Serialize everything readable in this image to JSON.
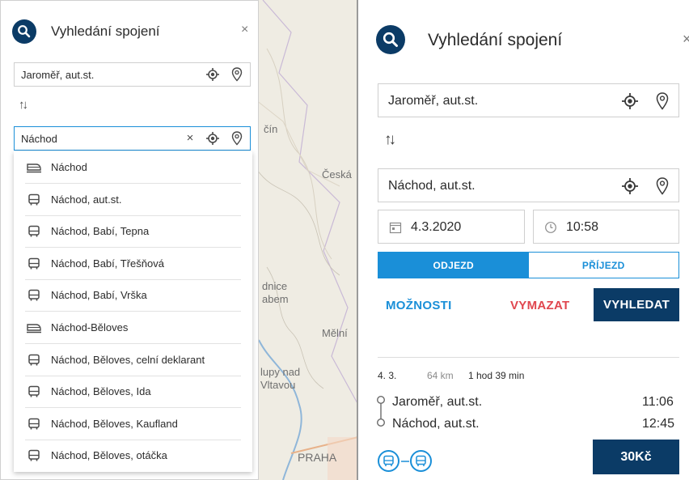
{
  "left": {
    "title": "Vyhledání spojení",
    "close": "×",
    "from_value": "Jaroměř, aut.st.",
    "to_value": "Náchod",
    "clear": "×",
    "swap": "↑↓",
    "map_labels": [
      "čín",
      "Česká",
      "dnice",
      "abem",
      "Mělní",
      "lupy nad",
      "Vltavou",
      "PRAHA"
    ],
    "suggestions": [
      {
        "label": "Náchod",
        "icon": "train-icon"
      },
      {
        "label": "Náchod, aut.st.",
        "icon": "bus-icon"
      },
      {
        "label": "Náchod, Babí, Tepna",
        "icon": "bus-icon"
      },
      {
        "label": "Náchod, Babí, Třešňová",
        "icon": "bus-icon"
      },
      {
        "label": "Náchod, Babí, Vrška",
        "icon": "bus-icon"
      },
      {
        "label": "Náchod-Běloves",
        "icon": "train-icon"
      },
      {
        "label": "Náchod, Běloves, celní deklarant",
        "icon": "bus-icon"
      },
      {
        "label": "Náchod, Běloves, Ida",
        "icon": "bus-icon"
      },
      {
        "label": "Náchod, Běloves, Kaufland",
        "icon": "bus-icon"
      },
      {
        "label": "Náchod, Běloves, otáčka",
        "icon": "bus-icon"
      }
    ]
  },
  "right": {
    "title": "Vyhledání spojení",
    "close": "×",
    "from_value": "Jaroměř, aut.st.",
    "swap": "↑↓",
    "to_value": "Náchod, aut.st.",
    "date": "4.3.2020",
    "time": "10:58",
    "departure_label": "ODJEZD",
    "arrival_label": "PŘÍJEZD",
    "options_label": "MOŽNOSTI",
    "clear_label": "VYMAZAT",
    "search_label": "VYHLEDAT",
    "result": {
      "date": "4. 3.",
      "distance": "64 km",
      "duration": "1 hod 39 min",
      "from_stop": "Jaroměř, aut.st.",
      "from_time": "11:06",
      "to_stop": "Náchod, aut.st.",
      "to_time": "12:45",
      "price": "30Kč"
    },
    "colors": {
      "accent": "#1a8fd8",
      "dark": "#0b3b66",
      "red": "#e0464e"
    }
  }
}
